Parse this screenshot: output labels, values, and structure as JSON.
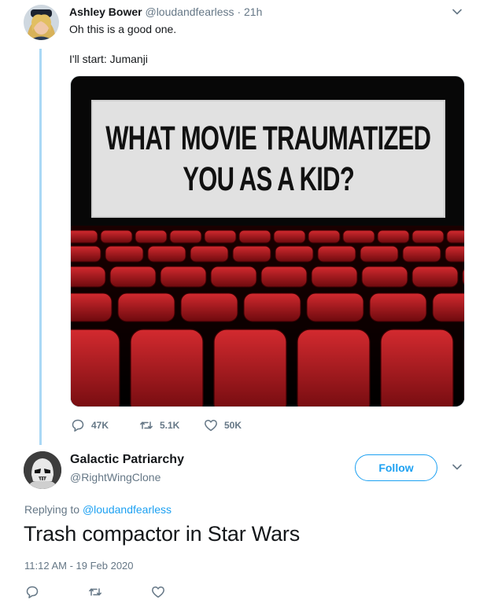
{
  "tweet1": {
    "display_name": "Ashley Bower",
    "handle": "@loudandfearless",
    "separator": "·",
    "time": "21h",
    "text_line1": "Oh this is a good one.",
    "text_line2": "I'll start: Jumanji",
    "image": {
      "line1": "WHAT MOVIE TRAUMATIZED",
      "line2": "YOU AS A KID?"
    },
    "stats": {
      "replies": "47K",
      "retweets": "5.1K",
      "likes": "50K"
    }
  },
  "tweet2": {
    "display_name": "Galactic Patriarchy",
    "handle": "@RightWingClone",
    "follow_label": "Follow",
    "replying_prefix": "Replying to",
    "replying_handle": "@loudandfearless",
    "text": "Trash compactor in Star Wars",
    "timestamp": "11:12 AM - 19 Feb 2020"
  },
  "colors": {
    "accent": "#1da1f2",
    "muted": "#657786",
    "thread_line": "#aad8f5",
    "seat_red": "#b3141c"
  },
  "icons": [
    "reply-icon",
    "retweet-icon",
    "like-icon",
    "chevron-down-icon"
  ]
}
